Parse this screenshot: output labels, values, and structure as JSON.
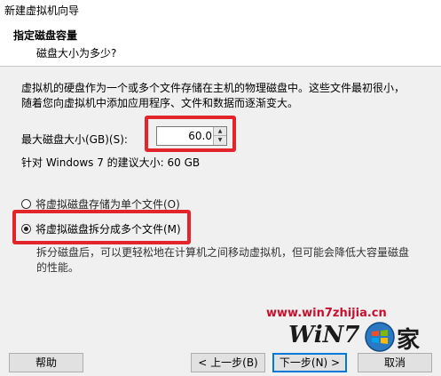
{
  "window": {
    "title": "新建虚拟机向导"
  },
  "header": {
    "title": "指定磁盘容量",
    "subtitle": "磁盘大小为多少?"
  },
  "description": "虚拟机的硬盘作为一个或多个文件存储在主机的物理磁盘中。这些文件最初很小，随着您向虚拟机中添加应用程序、文件和数据而逐渐变大。",
  "disk_size": {
    "label": "最大磁盘大小(GB)(S):",
    "value": "60.0",
    "recommendation": "针对 Windows 7 的建议大小: 60 GB"
  },
  "storage_options": [
    {
      "label": "将虚拟磁盘存储为单个文件(O)",
      "selected": false
    },
    {
      "label": "将虚拟磁盘拆分成多个文件(M)",
      "selected": true
    }
  ],
  "split_note": "拆分磁盘后，可以更轻松地在计算机之间移动虚拟机，但可能会降低大容量磁盘的性能。",
  "watermark": {
    "url": "www.win7zhijia.cn",
    "logo_text": "WiN7",
    "logo_suffix": "家"
  },
  "buttons": {
    "help": "帮助",
    "back": "< 上一步(B)",
    "next": "下一步(N) >",
    "cancel": "取消"
  },
  "colors": {
    "highlight": "#e3242b",
    "accent": "#0078d7"
  }
}
